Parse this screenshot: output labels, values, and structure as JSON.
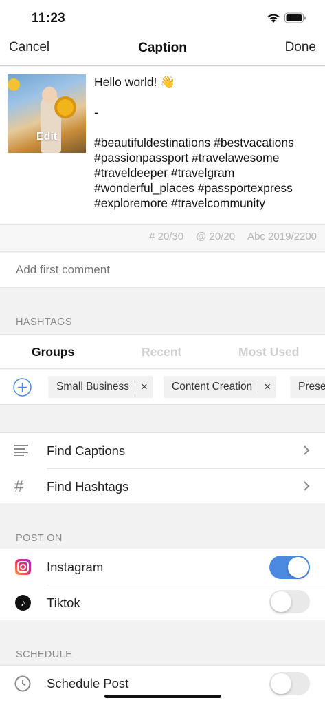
{
  "status_bar": {
    "time": "11:23"
  },
  "nav": {
    "cancel": "Cancel",
    "title": "Caption",
    "done": "Done"
  },
  "caption": {
    "thumbnail_edit": "Edit",
    "lines": [
      "Hello world! 👋",
      "",
      "-",
      "",
      "#beautifuldestinations #bestvacations",
      "#passionpassport #travelawesome",
      "#traveldeeper #travelgram",
      "#wonderful_places #passportexpress",
      "#exploremore #travelcommunity"
    ]
  },
  "counts": {
    "hashtags": "# 20/30",
    "mentions": "@ 20/20",
    "characters": "Abc 2019/2200"
  },
  "comment": {
    "placeholder": "Add first comment"
  },
  "hashtags": {
    "header": "HASHTAGS",
    "tabs": [
      {
        "label": "Groups",
        "active": true
      },
      {
        "label": "Recent",
        "active": false
      },
      {
        "label": "Most Used",
        "active": false
      }
    ],
    "groups": [
      "Small Business",
      "Content Creation",
      "Prese"
    ]
  },
  "menu": {
    "find_captions": "Find Captions",
    "find_hashtags": "Find Hashtags"
  },
  "post_on": {
    "header": "POST ON",
    "platforms": [
      {
        "name": "Instagram",
        "icon": "instagram-icon",
        "enabled": true
      },
      {
        "name": "Tiktok",
        "icon": "tiktok-icon",
        "enabled": false
      }
    ]
  },
  "schedule": {
    "header": "SCHEDULE",
    "label": "Schedule Post",
    "enabled": false
  },
  "colors": {
    "accent": "#4c8ae2",
    "toggle_off": "#e9e9ea",
    "muted_text": "#8a8a8a"
  }
}
